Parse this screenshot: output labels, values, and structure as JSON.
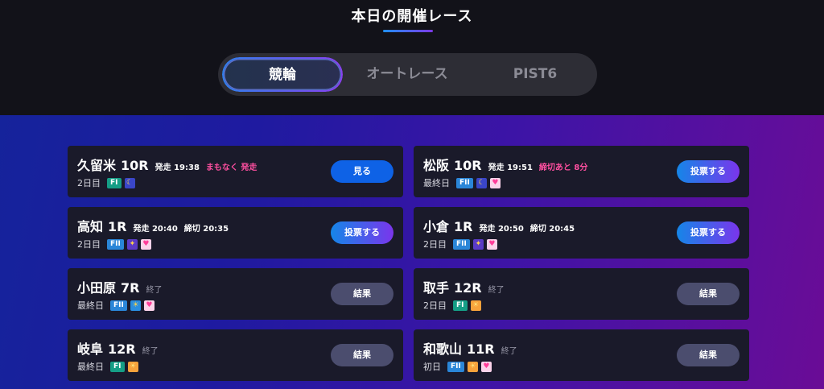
{
  "header": {
    "title": "本日の開催レース"
  },
  "tabs": [
    {
      "label": "競輪",
      "active": true
    },
    {
      "label": "オートレース",
      "active": false
    },
    {
      "label": "PIST6",
      "active": false
    }
  ],
  "cards": [
    {
      "venue": "久留米",
      "race": "10R",
      "meta1": "発走 19:38",
      "meta2": "まもなく 発走",
      "meta2_style": "pink",
      "day": "2日目",
      "grade": "FI",
      "icons": [
        "moon-icon"
      ],
      "button": "見る",
      "button_style": "watch"
    },
    {
      "venue": "松阪",
      "race": "10R",
      "meta1": "発走 19:51",
      "meta2": "締切あと 8分",
      "meta2_style": "pink",
      "day": "最終日",
      "grade": "FII",
      "icons": [
        "moon-icon",
        "heart-icon"
      ],
      "button": "投票する",
      "button_style": "vote"
    },
    {
      "venue": "高知",
      "race": "1R",
      "meta1": "発走 20:40",
      "meta2": "締切 20:35",
      "meta2_style": "white",
      "day": "2日目",
      "grade": "FII",
      "icons": [
        "star-icon",
        "heart-icon"
      ],
      "button": "投票する",
      "button_style": "vote"
    },
    {
      "venue": "小倉",
      "race": "1R",
      "meta1": "発走 20:50",
      "meta2": "締切 20:45",
      "meta2_style": "white",
      "day": "2日目",
      "grade": "FII",
      "icons": [
        "star-icon",
        "heart-icon"
      ],
      "button": "投票する",
      "button_style": "vote"
    },
    {
      "venue": "小田原",
      "race": "7R",
      "meta1": "終了",
      "meta2": "",
      "meta2_style": "gray",
      "day": "最終日",
      "grade": "FII",
      "icons": [
        "morning-icon",
        "heart-icon"
      ],
      "button": "結果",
      "button_style": "result"
    },
    {
      "venue": "取手",
      "race": "12R",
      "meta1": "終了",
      "meta2": "",
      "meta2_style": "gray",
      "day": "2日目",
      "grade": "FI",
      "icons": [
        "sun-icon"
      ],
      "button": "結果",
      "button_style": "result"
    },
    {
      "venue": "岐阜",
      "race": "12R",
      "meta1": "終了",
      "meta2": "",
      "meta2_style": "gray",
      "day": "最終日",
      "grade": "FI",
      "icons": [
        "sun-icon"
      ],
      "button": "結果",
      "button_style": "result"
    },
    {
      "venue": "和歌山",
      "race": "11R",
      "meta1": "終了",
      "meta2": "",
      "meta2_style": "gray",
      "day": "初日",
      "grade": "FII",
      "icons": [
        "sun-icon",
        "heart-icon"
      ],
      "button": "結果",
      "button_style": "result"
    }
  ],
  "colors": {
    "accent_blue": "#0e62e6",
    "accent_purple": "#7a35ec",
    "alert_pink": "#ff4fa0",
    "grade_fi": "#159e86",
    "grade_fii": "#2a86d8"
  }
}
